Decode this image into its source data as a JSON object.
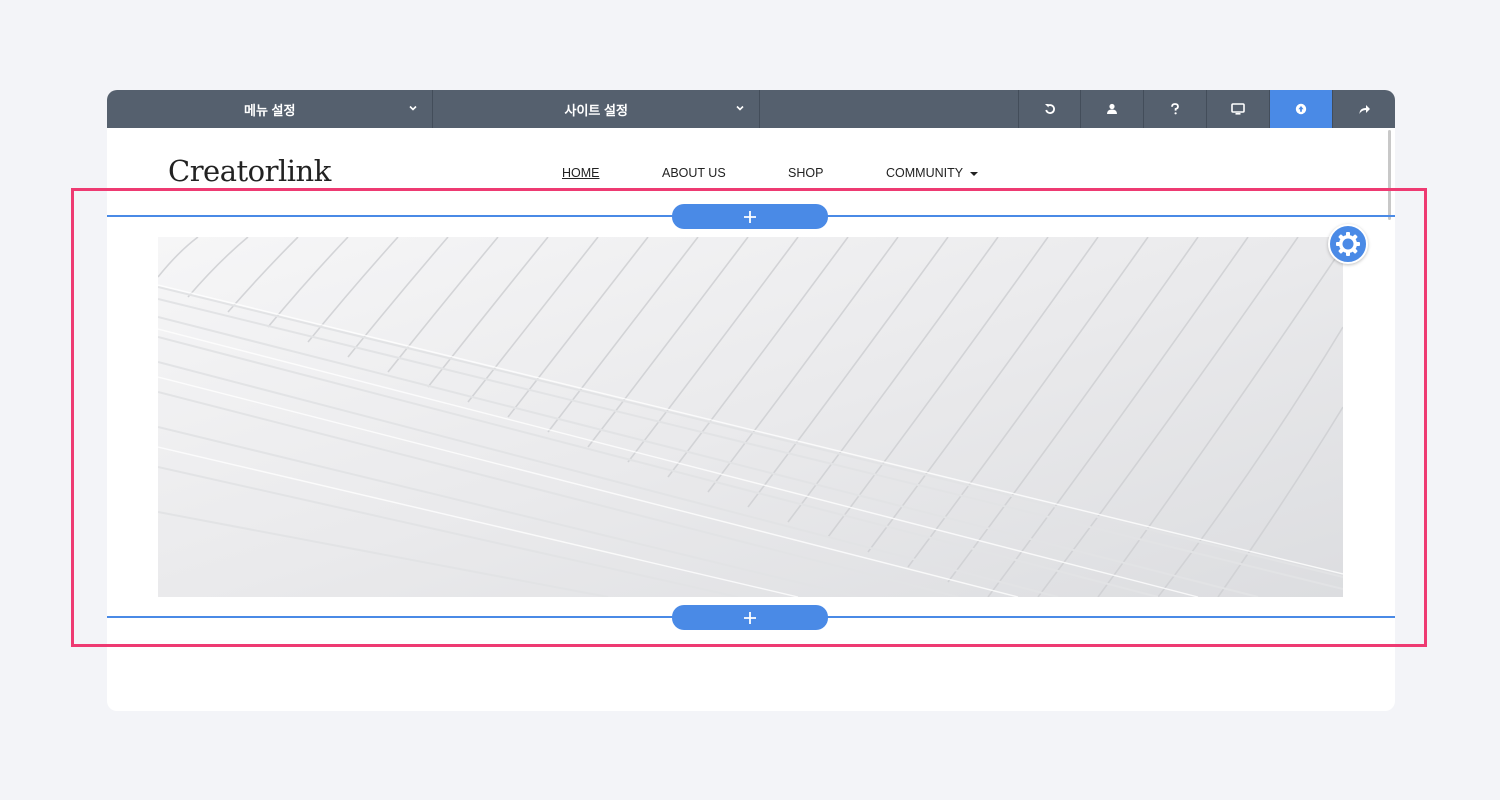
{
  "toolbar": {
    "menu_settings_label": "메뉴 설정",
    "site_settings_label": "사이트 설정",
    "buttons": [
      {
        "icon": "undo-icon"
      },
      {
        "icon": "user-icon"
      },
      {
        "icon": "help-icon"
      },
      {
        "icon": "desktop-preview-icon"
      },
      {
        "icon": "publish-icon",
        "active": true
      },
      {
        "icon": "share-icon"
      }
    ],
    "background_color": "#55606e",
    "active_color": "#4a8ae6"
  },
  "site": {
    "logo": "Creatorlink",
    "nav": {
      "items": [
        {
          "label": "HOME",
          "current": true
        },
        {
          "label": "ABOUT US"
        },
        {
          "label": "SHOP"
        },
        {
          "label": "COMMUNITY",
          "has_dropdown": true
        }
      ]
    }
  },
  "section": {
    "add_button_top_icon": "plus-icon",
    "add_button_bottom_icon": "plus-icon",
    "settings_icon": "gear-icon",
    "image": "abstract white curved architecture",
    "accent_color": "#4a8ae6",
    "highlight_color": "#ee3a72"
  }
}
